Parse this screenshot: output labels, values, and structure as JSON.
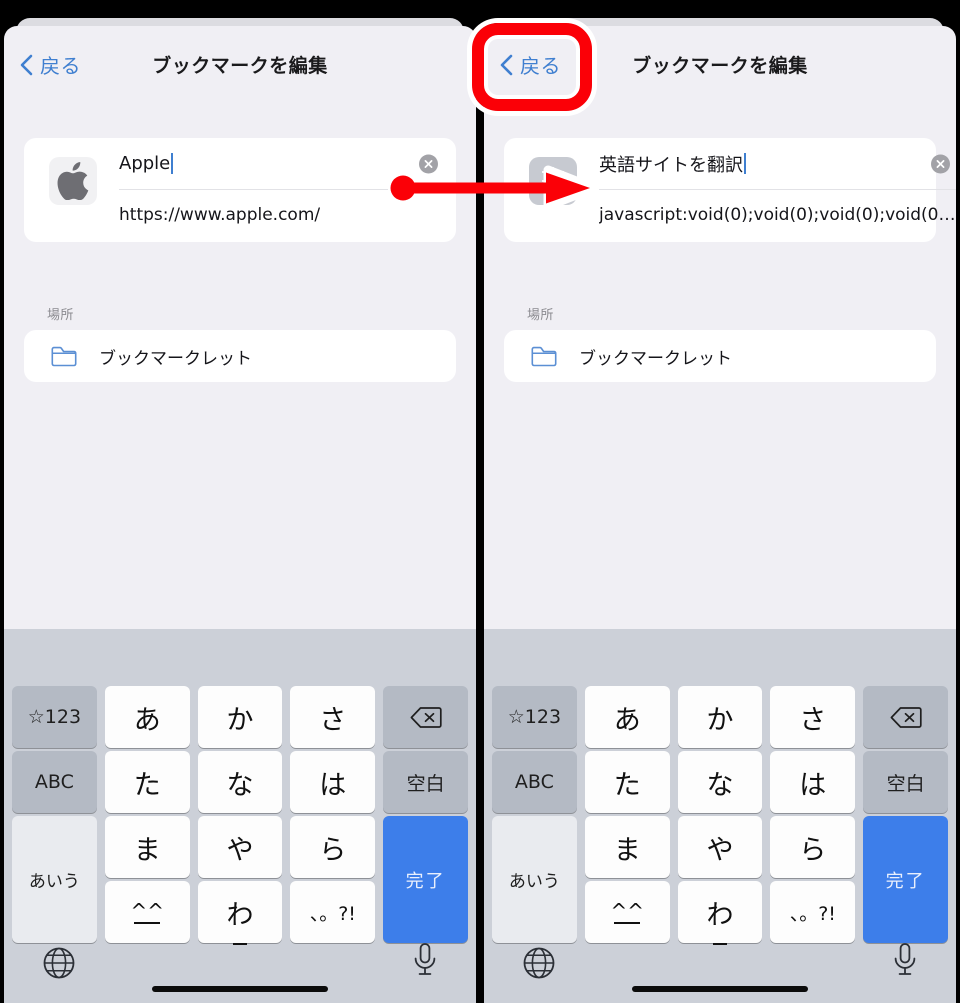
{
  "panels": [
    {
      "id": "left",
      "nav": {
        "back_label": "戻る",
        "title": "ブックマークを編集"
      },
      "bookmark": {
        "favicon": "apple-logo-icon",
        "title_value": "Apple",
        "url_value": "https://www.apple.com/",
        "clear_icon": "clear-circle-icon"
      },
      "location": {
        "label": "場所",
        "folder_icon": "folder-icon",
        "folder_name": "ブックマークレット"
      }
    },
    {
      "id": "right",
      "nav": {
        "back_label": "戻る",
        "title": "ブックマークを編集"
      },
      "bookmark": {
        "favicon": "bookmarklet-script-icon",
        "title_value": "英語サイトを翻訳",
        "url_value": "javascript:void(0);void(0);void(0);void(0…",
        "clear_icon": "clear-circle-icon"
      },
      "location": {
        "label": "場所",
        "folder_icon": "folder-icon",
        "folder_name": "ブックマークレット"
      }
    }
  ],
  "keyboard": {
    "keys": {
      "symbols": "☆123",
      "a": "あ",
      "ka": "か",
      "sa": "さ",
      "delete_icon": "delete-backward-icon",
      "abc": "ABC",
      "ta": "た",
      "na": "な",
      "ha": "は",
      "space": "空白",
      "kana": "あいう",
      "ma": "ま",
      "ya": "や",
      "ra": "ら",
      "done": "完了",
      "emoji": "^^",
      "wa": "わ",
      "punct": "、。?!"
    },
    "globe_icon": "globe-icon",
    "mic_icon": "microphone-icon"
  },
  "annotations": {
    "highlight_box": {
      "target": "back-button-right-panel",
      "color": "#fb0007"
    },
    "arrow": {
      "from": "left-panel-bookmark-card",
      "to": "right-panel-bookmark-icon",
      "color": "#fb0007"
    }
  },
  "colors": {
    "accent_blue": "#3f7fd0",
    "key_blue": "#3d7eea",
    "page_bg": "#f0eff4",
    "keyboard_bg": "#ccd0d8",
    "annotation_red": "#fb0007"
  }
}
